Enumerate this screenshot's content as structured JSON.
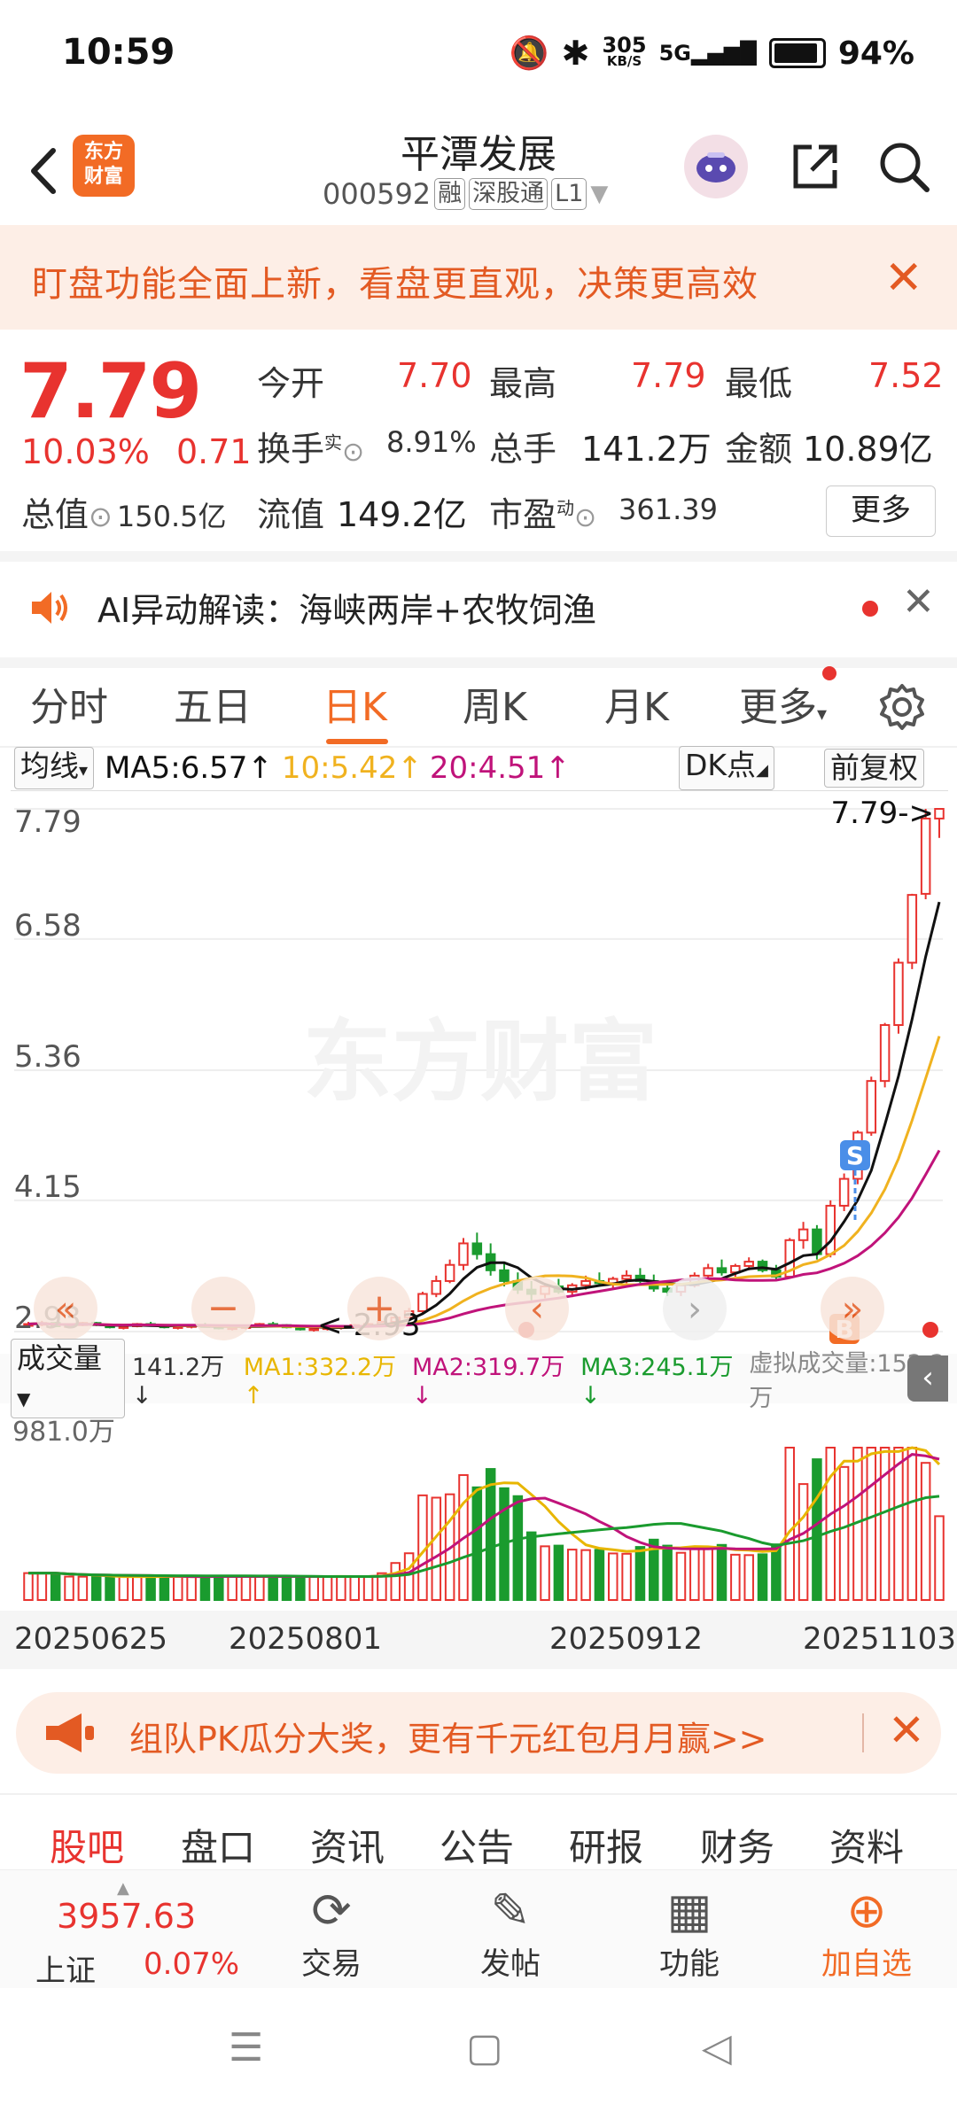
{
  "status": {
    "time": "10:59",
    "net_speed_top": "305",
    "net_speed_unit": "KB/S",
    "network": "5G",
    "battery": "94%"
  },
  "header": {
    "title": "平潭发展",
    "code": "000592",
    "tags": [
      "融",
      "深股通",
      "L1"
    ]
  },
  "banner": {
    "text": "盯盘功能全面上新，看盘更直观，决策更高效"
  },
  "logo": {
    "line1": "东方",
    "line2": "财富"
  },
  "quote": {
    "price": "7.79",
    "change_pct": "10.03%",
    "change": "0.71",
    "open_label": "今开",
    "open": "7.70",
    "high_label": "最高",
    "high": "7.79",
    "low_label": "最低",
    "low": "7.52",
    "turnover_label": "换手",
    "turnover_sup": "实",
    "turnover": "8.91%",
    "volume_label": "总手",
    "volume": "141.2万",
    "amount_label": "金额",
    "amount": "10.89亿",
    "mcap_label": "总值",
    "mcap": "150.5亿",
    "float_label": "流值",
    "float": "149.2亿",
    "pe_label": "市盈",
    "pe_sup": "动",
    "pe": "361.39",
    "more": "更多"
  },
  "ai": {
    "text": "AI异动解读：海峡两岸+农牧饲渔"
  },
  "ktabs": [
    "分时",
    "五日",
    "日K",
    "周K",
    "月K",
    "更多"
  ],
  "ma_row": {
    "selector": "均线",
    "ma5": "MA5:6.57↑",
    "ma10": "10:5.42↑",
    "ma20": "20:4.51↑",
    "dk": "DK点",
    "adjust": "前复权"
  },
  "kchart": {
    "y_labels": [
      "7.79",
      "6.58",
      "5.36",
      "4.15",
      "2.93"
    ],
    "max_annot": "7.79->",
    "min_annot": "<-2.93",
    "watermark": "东方财富",
    "marker_s": "S",
    "marker_b": "B"
  },
  "vol_row": {
    "selector": "成交量",
    "vol": "141.2万↓",
    "ma1": "MA1:332.2万↑",
    "ma2": "MA2:319.7万↓",
    "ma3": "MA3:245.1万↓",
    "virtual": "虚拟成交量:152.2万"
  },
  "vchart": {
    "max_label": "981.0万"
  },
  "dates": [
    "20250625",
    "20250801",
    "20250912",
    "20251103"
  ],
  "promo2": {
    "text": "组队PK瓜分大奖，更有千元红包月月赢>>"
  },
  "btabs": [
    "股吧",
    "盘口",
    "资讯",
    "公告",
    "研报",
    "财务",
    "资料"
  ],
  "toolbar": {
    "index_value": "3957.63",
    "index_name": "上证",
    "index_change": "0.07%",
    "trade": "交易",
    "post": "发帖",
    "func": "功能",
    "add": "加自选"
  },
  "colors": {
    "up": "#e8332f",
    "down": "#1a9b2e",
    "accent": "#f26b25",
    "ma5": "#111111",
    "ma10": "#f0b21f",
    "ma20": "#c0137a"
  },
  "chart_data": {
    "type": "candlestick",
    "price_range": [
      2.93,
      7.79
    ],
    "volume_max": "981.0万",
    "candles": [
      [
        3.0,
        3.02,
        2.97,
        3.0
      ],
      [
        3.0,
        3.03,
        2.98,
        3.01
      ],
      [
        3.01,
        3.02,
        2.97,
        2.98
      ],
      [
        2.98,
        3.0,
        2.96,
        2.99
      ],
      [
        2.99,
        3.02,
        2.98,
        3.01
      ],
      [
        3.01,
        3.02,
        2.98,
        2.99
      ],
      [
        2.99,
        3.0,
        2.96,
        2.97
      ],
      [
        2.97,
        2.99,
        2.95,
        2.98
      ],
      [
        2.98,
        3.01,
        2.97,
        3.0
      ],
      [
        3.0,
        3.02,
        2.98,
        2.99
      ],
      [
        2.99,
        3.0,
        2.96,
        2.97
      ],
      [
        2.97,
        2.99,
        2.95,
        2.98
      ],
      [
        2.98,
        3.0,
        2.96,
        2.99
      ],
      [
        2.99,
        3.01,
        2.97,
        2.98
      ],
      [
        2.98,
        2.99,
        2.95,
        2.96
      ],
      [
        2.96,
        2.98,
        2.94,
        2.97
      ],
      [
        2.97,
        2.99,
        2.95,
        2.98
      ],
      [
        2.98,
        3.01,
        2.97,
        3.0
      ],
      [
        3.0,
        3.02,
        2.98,
        2.99
      ],
      [
        2.99,
        3.0,
        2.96,
        2.97
      ],
      [
        2.97,
        2.98,
        2.94,
        2.95
      ],
      [
        2.95,
        2.97,
        2.93,
        2.96
      ],
      [
        2.96,
        2.98,
        2.94,
        2.97
      ],
      [
        2.97,
        2.99,
        2.95,
        2.98
      ],
      [
        2.98,
        3.0,
        2.96,
        2.99
      ],
      [
        2.99,
        3.01,
        2.97,
        3.0
      ],
      [
        3.0,
        3.03,
        2.98,
        3.02
      ],
      [
        3.02,
        3.08,
        3.0,
        3.06
      ],
      [
        3.06,
        3.15,
        3.04,
        3.12
      ],
      [
        3.12,
        3.3,
        3.1,
        3.28
      ],
      [
        3.28,
        3.45,
        3.25,
        3.4
      ],
      [
        3.4,
        3.6,
        3.38,
        3.55
      ],
      [
        3.55,
        3.8,
        3.5,
        3.75
      ],
      [
        3.75,
        3.85,
        3.6,
        3.65
      ],
      [
        3.65,
        3.75,
        3.45,
        3.5
      ],
      [
        3.5,
        3.58,
        3.35,
        3.4
      ],
      [
        3.4,
        3.48,
        3.28,
        3.32
      ],
      [
        3.32,
        3.4,
        3.22,
        3.28
      ],
      [
        3.28,
        3.38,
        3.24,
        3.35
      ],
      [
        3.35,
        3.42,
        3.28,
        3.3
      ],
      [
        3.3,
        3.38,
        3.25,
        3.36
      ],
      [
        3.36,
        3.45,
        3.32,
        3.4
      ],
      [
        3.4,
        3.48,
        3.35,
        3.38
      ],
      [
        3.38,
        3.44,
        3.32,
        3.42
      ],
      [
        3.42,
        3.5,
        3.38,
        3.45
      ],
      [
        3.45,
        3.52,
        3.38,
        3.4
      ],
      [
        3.4,
        3.46,
        3.3,
        3.33
      ],
      [
        3.33,
        3.4,
        3.26,
        3.3
      ],
      [
        3.3,
        3.38,
        3.26,
        3.36
      ],
      [
        3.36,
        3.48,
        3.34,
        3.45
      ],
      [
        3.45,
        3.56,
        3.42,
        3.52
      ],
      [
        3.52,
        3.6,
        3.45,
        3.48
      ],
      [
        3.48,
        3.56,
        3.44,
        3.54
      ],
      [
        3.54,
        3.62,
        3.5,
        3.58
      ],
      [
        3.58,
        3.6,
        3.48,
        3.5
      ],
      [
        3.5,
        3.55,
        3.4,
        3.44
      ],
      [
        3.44,
        3.8,
        3.42,
        3.78
      ],
      [
        3.78,
        3.95,
        3.7,
        3.88
      ],
      [
        3.88,
        3.92,
        3.6,
        3.65
      ],
      [
        3.65,
        4.15,
        3.62,
        4.1
      ],
      [
        4.1,
        4.4,
        4.05,
        4.35
      ],
      [
        4.35,
        4.8,
        4.3,
        4.78
      ],
      [
        4.78,
        5.3,
        4.75,
        5.26
      ],
      [
        5.26,
        5.8,
        5.2,
        5.78
      ],
      [
        5.78,
        6.4,
        5.7,
        6.36
      ],
      [
        6.36,
        7.0,
        6.3,
        6.99
      ],
      [
        7.0,
        7.79,
        6.95,
        7.7
      ],
      [
        7.7,
        7.79,
        7.52,
        7.79
      ]
    ]
  }
}
